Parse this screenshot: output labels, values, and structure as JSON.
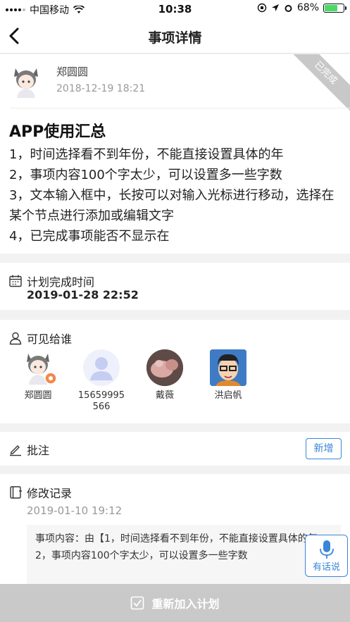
{
  "status_bar": {
    "carrier": "中国移动",
    "time": "10:38",
    "battery": "68%",
    "battery_level": 0.68
  },
  "nav": {
    "title": "事项详情"
  },
  "item": {
    "author": "郑圆圆",
    "datetime": "2018-12-19 18:21",
    "status_ribbon": "已完成",
    "title": "APP使用汇总",
    "lines": [
      "1，时间选择看不到年份，不能直接设置具体的年",
      "2，事项内容100个字太少，可以设置多一些字数",
      "3，文本输入框中，长按可以对输入光标进行移动，选择在某个节点进行添加或编辑文字",
      "4，已完成事项能否不显示在"
    ]
  },
  "plan": {
    "label": "计划完成时间",
    "value": "2019-01-28 22:52",
    "icon": "calendar-icon"
  },
  "visible": {
    "label": "可见给谁",
    "icon": "person-icon",
    "people": [
      {
        "name": "郑圆圆"
      },
      {
        "name": "15659995566"
      },
      {
        "name": "戴薇"
      },
      {
        "name": "洪启帆"
      }
    ]
  },
  "notes": {
    "label": "批注",
    "add_button": "新增",
    "icon": "pencil-icon"
  },
  "history": {
    "label": "修改记录",
    "icon": "notebook-icon",
    "date": "2019-01-10 19:12",
    "lines": [
      "事项内容：由【1，时间选择看不到年份，不能直接设置具体的年",
      "2，事项内容100个字太少，可以设置多一些字数"
    ]
  },
  "mic": {
    "label": "有话说"
  },
  "bottom_button": {
    "label": "重新加入计划"
  },
  "colors": {
    "accent": "#3a86d9",
    "disabled": "#c9c9c9",
    "battery": "#4cd964"
  }
}
